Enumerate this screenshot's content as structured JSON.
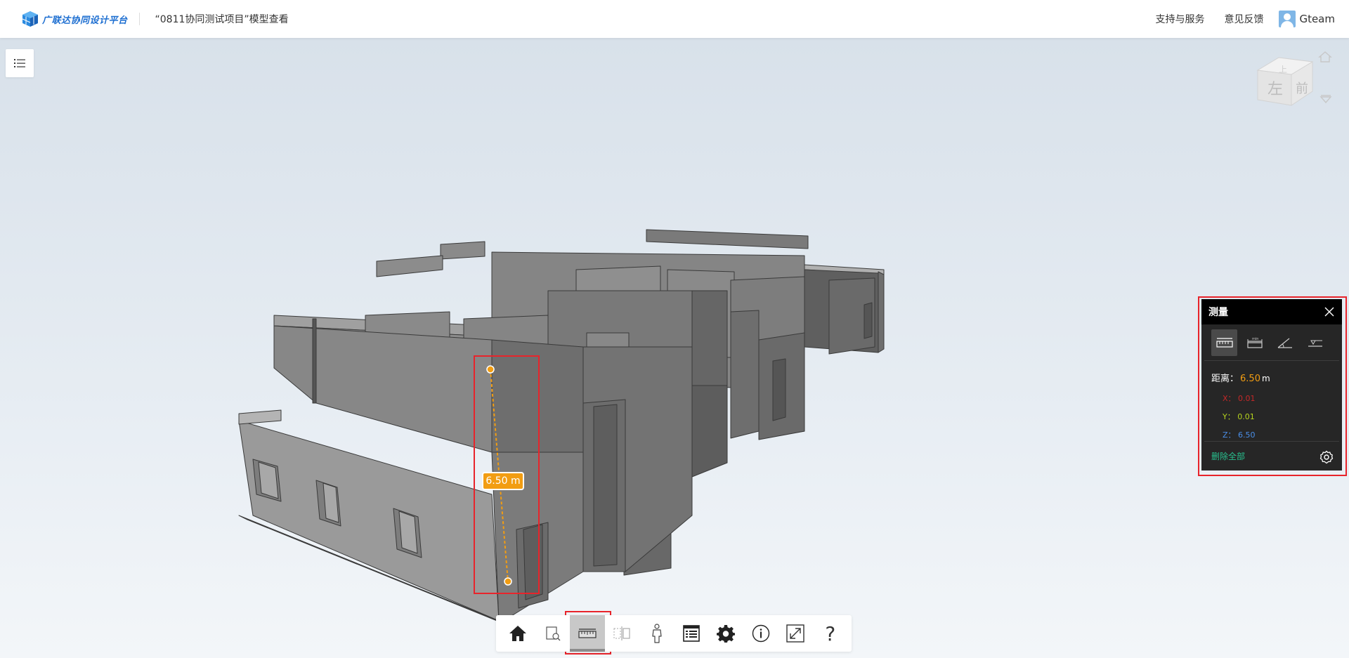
{
  "header": {
    "logo_text": "广联达协同设计平台",
    "project_title": "“0811协同测试项目”模型查看",
    "links": [
      "支持与服务",
      "意见反馈"
    ],
    "user_name": "Gteam"
  },
  "viewcube": {
    "left_face": "左",
    "front_face": "前",
    "top_face": "上"
  },
  "measurement": {
    "label": "6.50 m"
  },
  "measure_panel": {
    "title": "测量",
    "tools": [
      "distance-tool",
      "min-distance-tool",
      "angle-tool",
      "elevation-tool"
    ],
    "distance_label": "距离：",
    "distance_value": "6.50",
    "distance_unit": "m",
    "x_label": "X：",
    "x_value": "0.01",
    "y_label": "Y：",
    "y_value": "0.01",
    "z_label": "Z：",
    "z_value": "6.50",
    "delete_all": "删除全部",
    "min_label": "min"
  },
  "toolbar": {
    "items": [
      "home-icon",
      "section-box-icon",
      "measure-icon",
      "section-plane-icon",
      "walk-icon",
      "properties-icon",
      "settings-icon",
      "info-icon",
      "fullscreen-icon",
      "help-icon"
    ],
    "help_label": "?"
  },
  "colors": {
    "accent_orange": "#f29d12",
    "highlight_red": "#e8242b",
    "delete_green": "#28c08e",
    "brand_blue": "#1e6fd1"
  }
}
